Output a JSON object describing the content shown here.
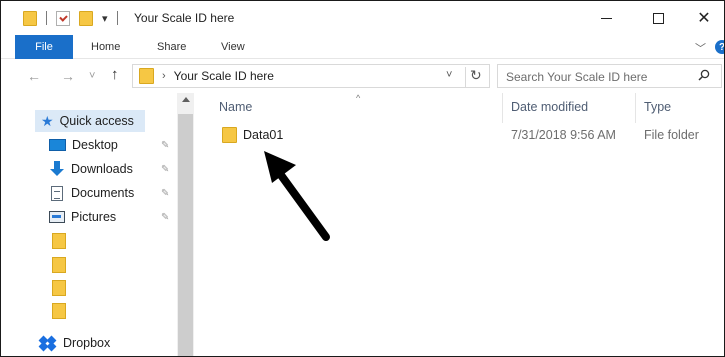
{
  "window": {
    "title": "Your Scale ID here",
    "controls": {
      "minimize": "minimize-icon",
      "maximize": "maximize-icon",
      "close": "✕"
    }
  },
  "quick_access_toolbar": {
    "dropdown": "▾"
  },
  "ribbon": {
    "tabs": [
      {
        "label": "File",
        "active": true
      },
      {
        "label": "Home"
      },
      {
        "label": "Share"
      },
      {
        "label": "View"
      }
    ],
    "expand_icon": "﹀",
    "help_icon": "?"
  },
  "nav": {
    "back": "←",
    "forward": "→",
    "recent": "˅",
    "up": "↑",
    "address": {
      "separator": "›",
      "path": "Your Scale ID here",
      "dropdown": "˅",
      "refresh": "↻"
    },
    "search": {
      "placeholder": "Search Your Scale ID here"
    }
  },
  "nav_pane": {
    "quick_access": "Quick access",
    "items": [
      {
        "label": "Desktop",
        "icon": "desktop-icon",
        "pinned": true
      },
      {
        "label": "Downloads",
        "icon": "downloads-icon",
        "pinned": true
      },
      {
        "label": "Documents",
        "icon": "documents-icon",
        "pinned": true
      },
      {
        "label": "Pictures",
        "icon": "pictures-icon",
        "pinned": true
      }
    ],
    "unlabeled_folders": 4,
    "dropbox": "Dropbox",
    "pin_glyph": "✎"
  },
  "file_list": {
    "columns": {
      "name": "Name",
      "date_modified": "Date modified",
      "type": "Type"
    },
    "sort_indicator": "^",
    "rows": [
      {
        "name": "Data01",
        "date_modified": "7/31/2018 9:56 AM",
        "type": "File folder"
      }
    ]
  },
  "colors": {
    "accent": "#1a6fc9",
    "folder": "#f6c744",
    "selection": "#dbe9f7",
    "annotation_arrow": "#000000"
  }
}
